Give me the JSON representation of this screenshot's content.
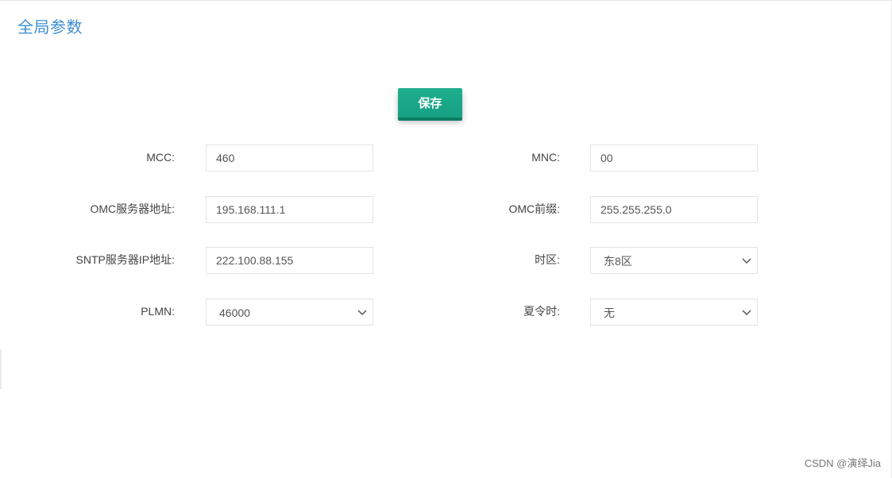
{
  "page": {
    "title": "全局参数"
  },
  "toolbar": {
    "save_label": "保存"
  },
  "fields": {
    "mcc": {
      "label": "MCC:",
      "value": "460"
    },
    "mnc": {
      "label": "MNC:",
      "value": "00"
    },
    "omc_server": {
      "label": "OMC服务器地址:",
      "value": "195.168.111.1"
    },
    "omc_prefix": {
      "label": "OMC前缀:",
      "value": "255.255.255.0"
    },
    "sntp_server": {
      "label": "SNTP服务器IP地址:",
      "value": "222.100.88.155"
    },
    "timezone": {
      "label": "时区:",
      "value": "东8区"
    },
    "plmn": {
      "label": "PLMN:",
      "value": "46000"
    },
    "dst": {
      "label": "夏令时:",
      "value": "无"
    }
  },
  "icons": {
    "dropdown": "chevron-down-icon"
  },
  "watermark": "CSDN @演绎Jia",
  "colors": {
    "title": "#3f8fd2",
    "save_button": "#1aa68a"
  }
}
